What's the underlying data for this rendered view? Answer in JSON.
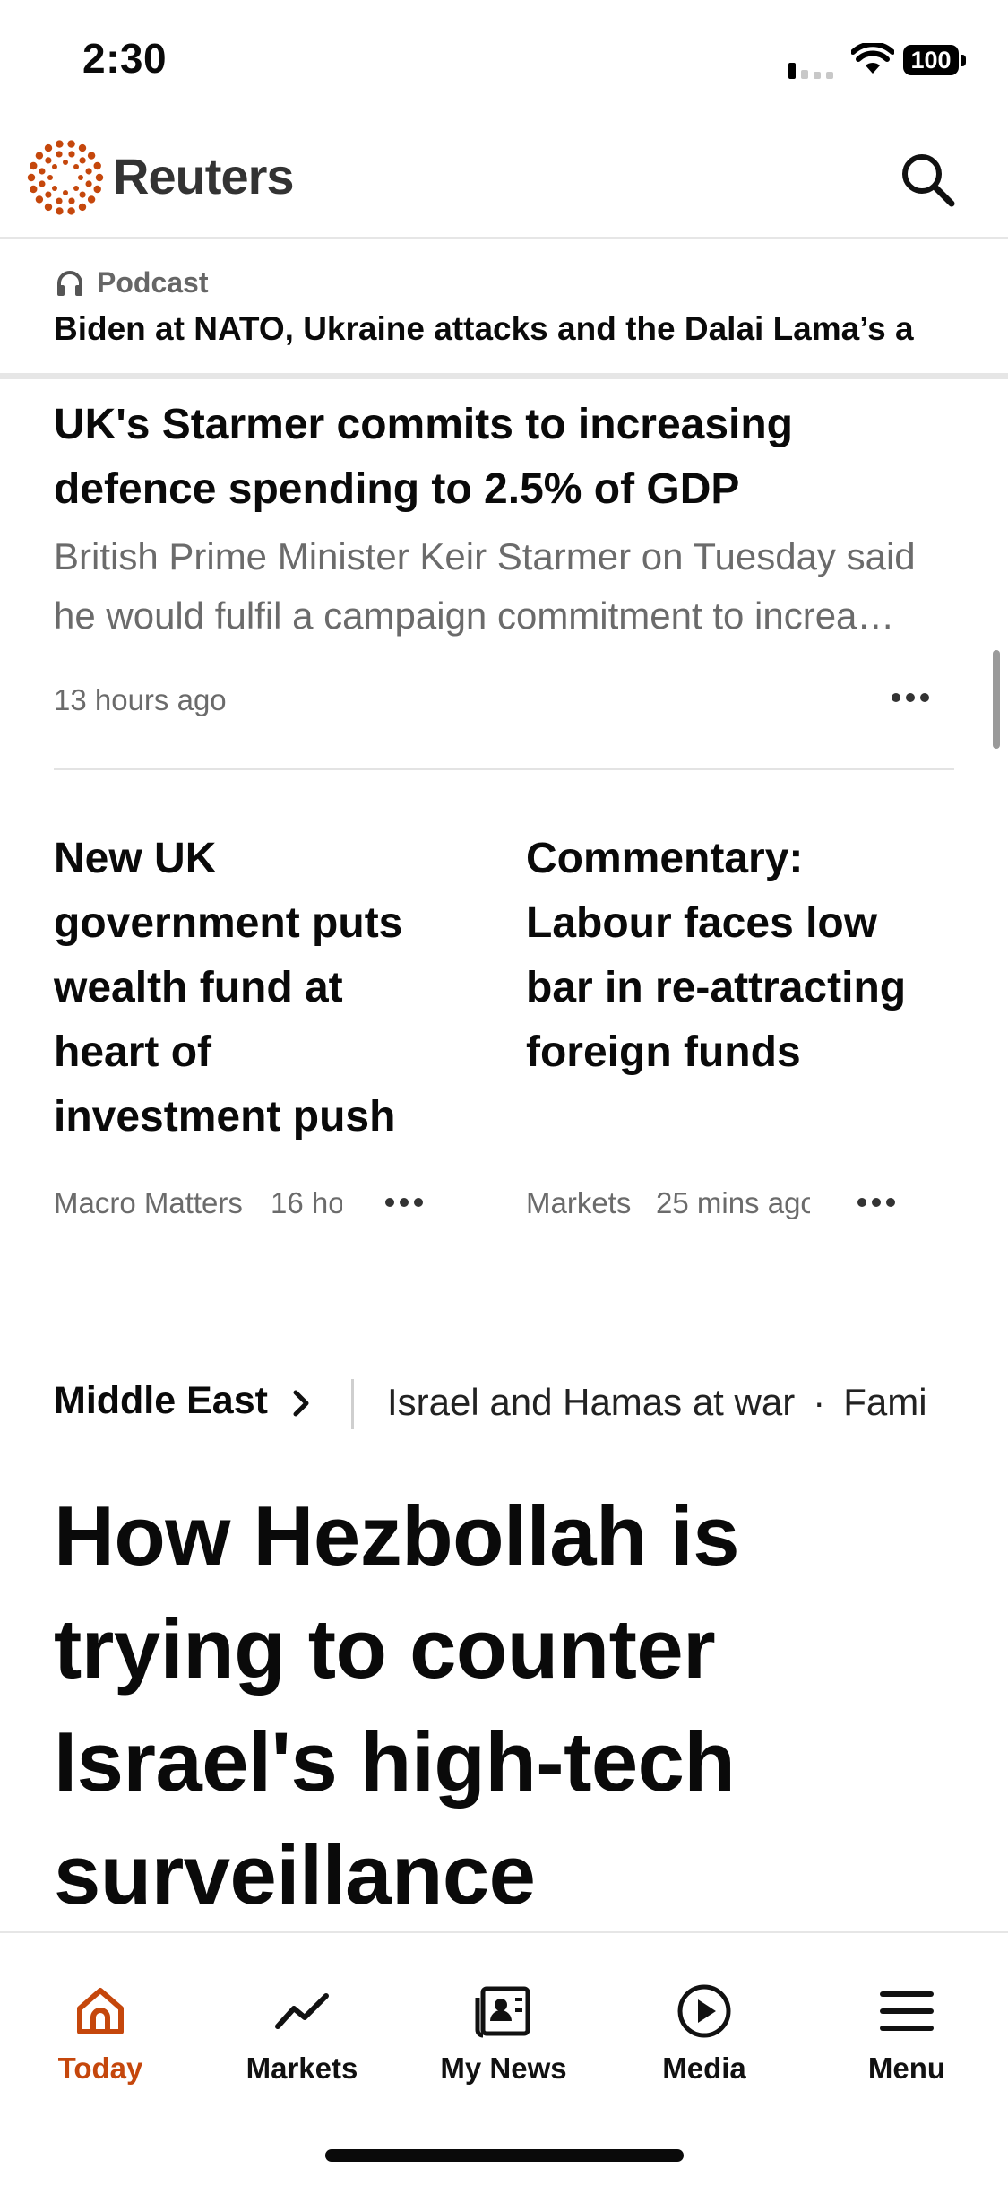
{
  "status_bar": {
    "time": "2:30",
    "battery": "100"
  },
  "header": {
    "brand": "Reuters",
    "accent_color": "#c5470c"
  },
  "podcast": {
    "label": "Podcast",
    "title": "Biden at NATO, Ukraine attacks and the Dalai Lama’s a"
  },
  "lead_story": {
    "headline": "UK's Starmer commits to increasing defence spending to 2.5% of GDP",
    "summary": "British Prime Minister Keir Starmer on Tuesday said he would fulfil a campaign commitment to increa…",
    "time": "13 hours ago"
  },
  "cards": [
    {
      "headline": "New UK government puts wealth fund at heart of investment push",
      "section": "Macro Matters",
      "time": "16 ho"
    },
    {
      "headline": "Commentary: Labour faces low bar in re-attracting foreign funds",
      "section": "Markets",
      "time": "25 mins ago"
    }
  ],
  "section_row": {
    "section": "Middle East",
    "topics": [
      "Israel and Hamas at war",
      "Fami"
    ]
  },
  "feature": {
    "headline": "How Hezbollah is trying to counter Israel's high-tech surveillance"
  },
  "tabs": [
    {
      "label": "Today",
      "icon": "home-icon",
      "active": true
    },
    {
      "label": "Markets",
      "icon": "trend-line-icon",
      "active": false
    },
    {
      "label": "My News",
      "icon": "news-icon",
      "active": false
    },
    {
      "label": "Media",
      "icon": "play-icon",
      "active": false
    },
    {
      "label": "Menu",
      "icon": "hamburger-icon",
      "active": false
    }
  ]
}
